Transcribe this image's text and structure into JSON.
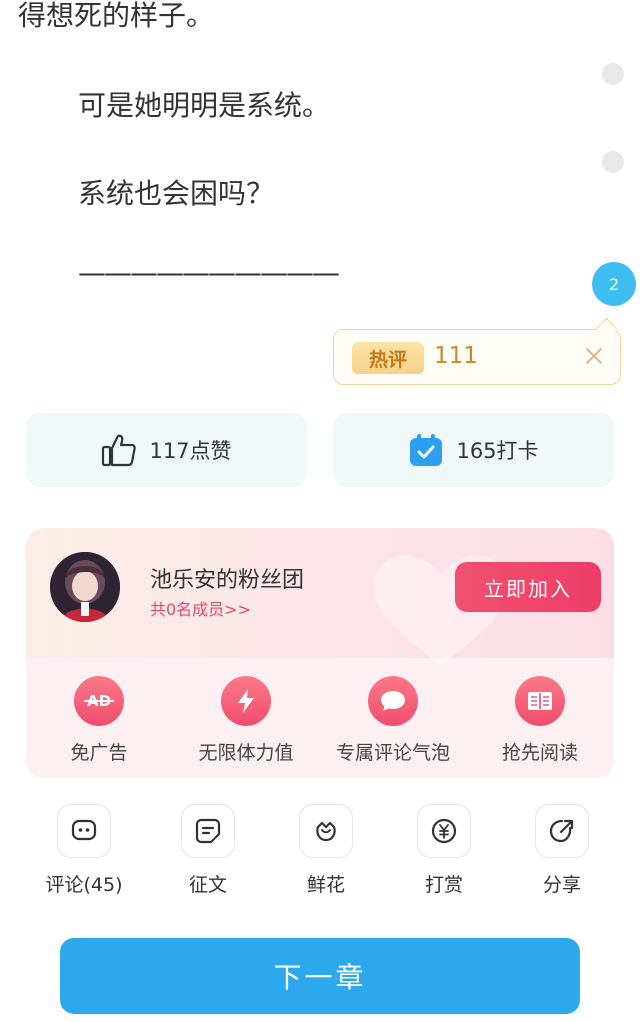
{
  "story": {
    "lines": [
      "得想死的样子。",
      "可是她明明是系统。",
      "系统也会困吗？",
      "——————————"
    ],
    "paragraph_comment_count": "2"
  },
  "hot_comment": {
    "tag": "热评",
    "text": "111"
  },
  "actions": {
    "like_label": "117点赞",
    "checkin_label": "165打卡"
  },
  "fan_club": {
    "title": "池乐安的粉丝团",
    "members": "共0名成员>>",
    "join_label": "立即加入",
    "perks": [
      {
        "label": "免广告",
        "icon": "ad-free-icon"
      },
      {
        "label": "无限体力值",
        "icon": "lightning-icon"
      },
      {
        "label": "专属评论气泡",
        "icon": "chat-bubble-icon"
      },
      {
        "label": "抢先阅读",
        "icon": "book-icon"
      }
    ]
  },
  "toolbar": {
    "items": [
      {
        "label": "评论(45)",
        "icon": "comment-icon"
      },
      {
        "label": "征文",
        "icon": "essay-icon"
      },
      {
        "label": "鲜花",
        "icon": "flower-icon"
      },
      {
        "label": "打赏",
        "icon": "reward-icon"
      },
      {
        "label": "分享",
        "icon": "share-icon"
      }
    ]
  },
  "next_chapter_label": "下一章",
  "colors": {
    "accent_blue": "#2ca9ec",
    "pink": "#ee3d66",
    "gold": "#c9892a"
  }
}
